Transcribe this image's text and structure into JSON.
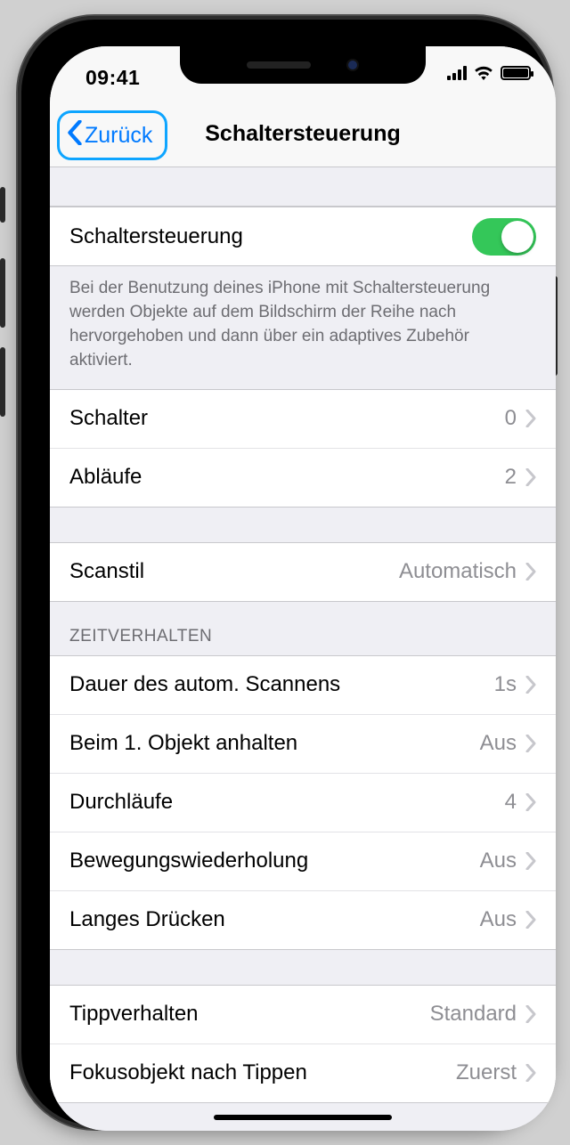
{
  "status": {
    "time": "09:41"
  },
  "nav": {
    "back": "Zurück",
    "title": "Schaltersteuerung"
  },
  "main_toggle": {
    "label": "Schaltersteuerung",
    "on": true
  },
  "footer_text": "Bei der Benutzung deines iPhone mit Schaltersteuerung werden Objekte auf dem Bildschirm der Reihe nach hervorgehoben und dann über ein adaptives Zubehör aktiviert.",
  "g1": {
    "schalter": {
      "label": "Schalter",
      "value": "0"
    },
    "ablaeufe": {
      "label": "Abläufe",
      "value": "2"
    }
  },
  "g2": {
    "scanstil": {
      "label": "Scanstil",
      "value": "Automatisch"
    }
  },
  "g3_header": "ZEITVERHALTEN",
  "g3": {
    "dauer": {
      "label": "Dauer des autom. Scannens",
      "value": "1s"
    },
    "anhalten": {
      "label": "Beim 1. Objekt anhalten",
      "value": "Aus"
    },
    "durchlaeufe": {
      "label": "Durchläufe",
      "value": "4"
    },
    "bewegung": {
      "label": "Bewegungswiederholung",
      "value": "Aus"
    },
    "langes": {
      "label": "Langes Drücken",
      "value": "Aus"
    }
  },
  "g4": {
    "tipp": {
      "label": "Tippverhalten",
      "value": "Standard"
    },
    "fokus": {
      "label": "Fokusobjekt nach Tippen",
      "value": "Zuerst"
    }
  }
}
